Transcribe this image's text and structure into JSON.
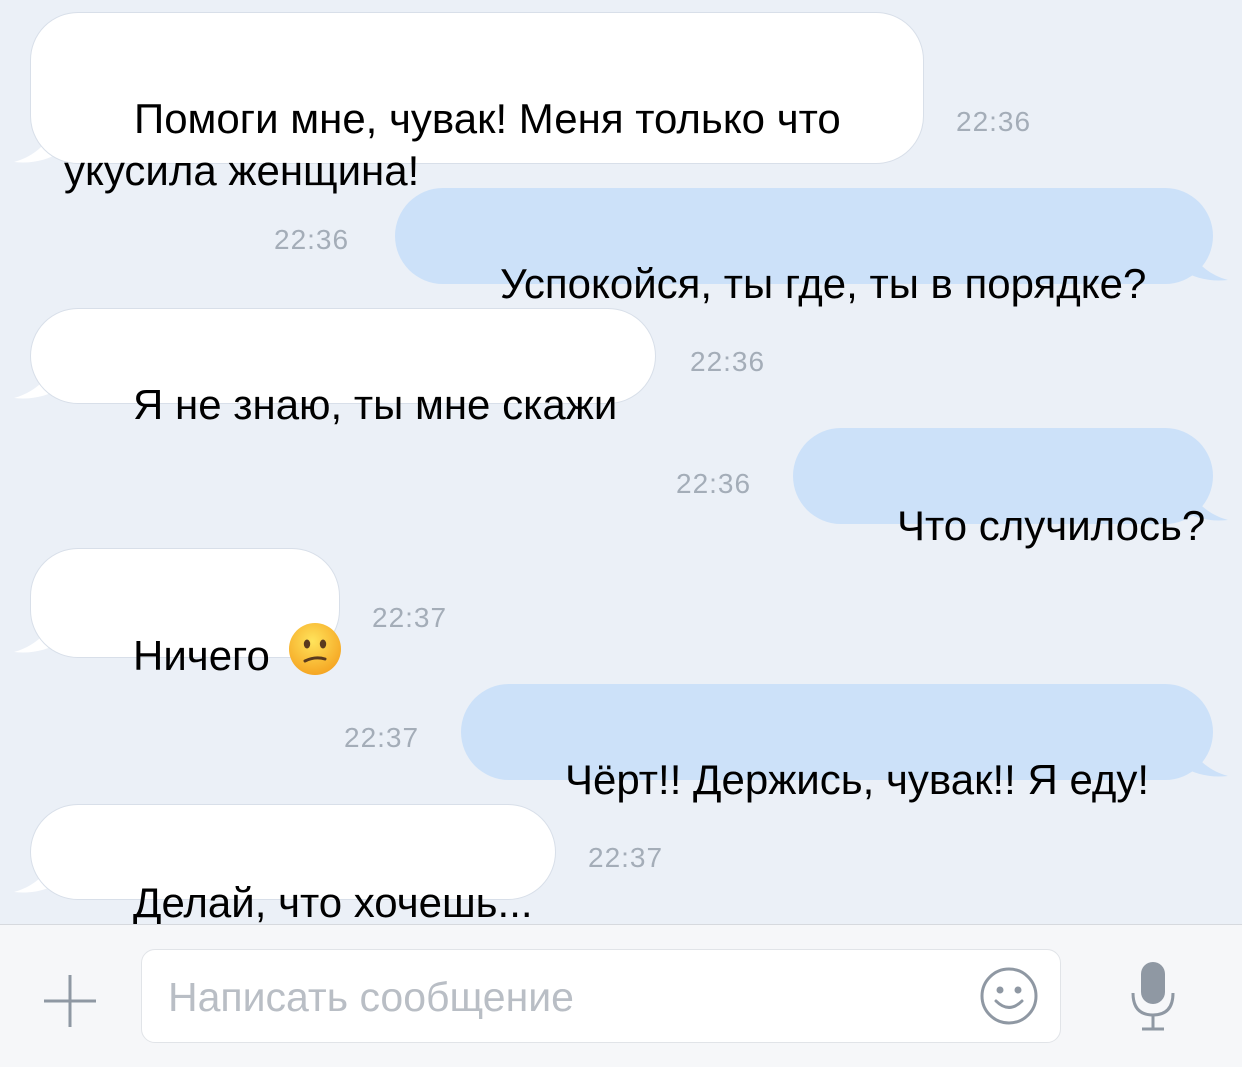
{
  "messages": [
    {
      "direction": "in",
      "text": "Помоги мне, чувак! Меня только что\nукусила женщина!",
      "time": "22:36"
    },
    {
      "direction": "out",
      "text": "Успокойся, ты где, ты в порядке?",
      "time": "22:36"
    },
    {
      "direction": "in",
      "text": "Я не знаю, ты мне скажи",
      "time": "22:36"
    },
    {
      "direction": "out",
      "text": "Что случилось?",
      "time": "22:36"
    },
    {
      "direction": "in",
      "text": "Ничего",
      "emoji": "confused-face",
      "time": "22:37"
    },
    {
      "direction": "out",
      "text": "Чёрт!! Держись, чувак!! Я еду!",
      "time": "22:37"
    },
    {
      "direction": "in",
      "text": "Делай, что хочешь...",
      "time": "22:37"
    }
  ],
  "composer": {
    "placeholder": "Написать сообщение",
    "attach_icon": "plus-icon",
    "emoji_icon": "smiley-icon",
    "mic_icon": "microphone-icon"
  },
  "colors": {
    "background": "#ebf0f7",
    "incoming_bubble": "#ffffff",
    "outgoing_bubble": "#cce1f9",
    "timestamp": "#a4adb8",
    "placeholder": "#b9bec5",
    "icon": "#8f98a3"
  }
}
